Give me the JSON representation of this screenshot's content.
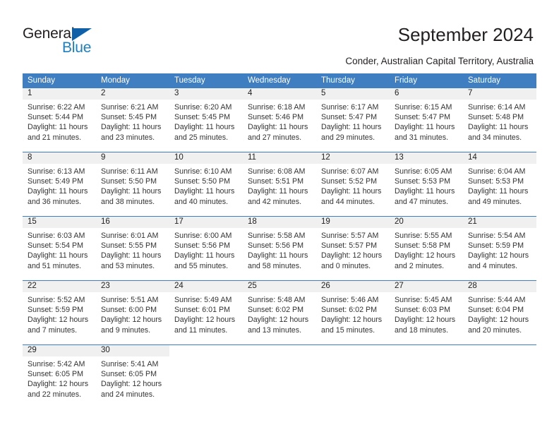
{
  "brand": {
    "logo_text_1": "General",
    "logo_text_2": "Blue",
    "logo_icon": "triangle-icon",
    "accent_color": "#1d7fc3",
    "header_blue": "#3f7fc1"
  },
  "header": {
    "title": "September 2024",
    "subtitle": "Conder, Australian Capital Territory, Australia"
  },
  "calendar": {
    "weekday_headers": [
      "Sunday",
      "Monday",
      "Tuesday",
      "Wednesday",
      "Thursday",
      "Friday",
      "Saturday"
    ],
    "weeks": [
      [
        {
          "day": "1",
          "sunrise": "Sunrise: 6:22 AM",
          "sunset": "Sunset: 5:44 PM",
          "daylight_1": "Daylight: 11 hours",
          "daylight_2": "and 21 minutes."
        },
        {
          "day": "2",
          "sunrise": "Sunrise: 6:21 AM",
          "sunset": "Sunset: 5:45 PM",
          "daylight_1": "Daylight: 11 hours",
          "daylight_2": "and 23 minutes."
        },
        {
          "day": "3",
          "sunrise": "Sunrise: 6:20 AM",
          "sunset": "Sunset: 5:45 PM",
          "daylight_1": "Daylight: 11 hours",
          "daylight_2": "and 25 minutes."
        },
        {
          "day": "4",
          "sunrise": "Sunrise: 6:18 AM",
          "sunset": "Sunset: 5:46 PM",
          "daylight_1": "Daylight: 11 hours",
          "daylight_2": "and 27 minutes."
        },
        {
          "day": "5",
          "sunrise": "Sunrise: 6:17 AM",
          "sunset": "Sunset: 5:47 PM",
          "daylight_1": "Daylight: 11 hours",
          "daylight_2": "and 29 minutes."
        },
        {
          "day": "6",
          "sunrise": "Sunrise: 6:15 AM",
          "sunset": "Sunset: 5:47 PM",
          "daylight_1": "Daylight: 11 hours",
          "daylight_2": "and 31 minutes."
        },
        {
          "day": "7",
          "sunrise": "Sunrise: 6:14 AM",
          "sunset": "Sunset: 5:48 PM",
          "daylight_1": "Daylight: 11 hours",
          "daylight_2": "and 34 minutes."
        }
      ],
      [
        {
          "day": "8",
          "sunrise": "Sunrise: 6:13 AM",
          "sunset": "Sunset: 5:49 PM",
          "daylight_1": "Daylight: 11 hours",
          "daylight_2": "and 36 minutes."
        },
        {
          "day": "9",
          "sunrise": "Sunrise: 6:11 AM",
          "sunset": "Sunset: 5:50 PM",
          "daylight_1": "Daylight: 11 hours",
          "daylight_2": "and 38 minutes."
        },
        {
          "day": "10",
          "sunrise": "Sunrise: 6:10 AM",
          "sunset": "Sunset: 5:50 PM",
          "daylight_1": "Daylight: 11 hours",
          "daylight_2": "and 40 minutes."
        },
        {
          "day": "11",
          "sunrise": "Sunrise: 6:08 AM",
          "sunset": "Sunset: 5:51 PM",
          "daylight_1": "Daylight: 11 hours",
          "daylight_2": "and 42 minutes."
        },
        {
          "day": "12",
          "sunrise": "Sunrise: 6:07 AM",
          "sunset": "Sunset: 5:52 PM",
          "daylight_1": "Daylight: 11 hours",
          "daylight_2": "and 44 minutes."
        },
        {
          "day": "13",
          "sunrise": "Sunrise: 6:05 AM",
          "sunset": "Sunset: 5:53 PM",
          "daylight_1": "Daylight: 11 hours",
          "daylight_2": "and 47 minutes."
        },
        {
          "day": "14",
          "sunrise": "Sunrise: 6:04 AM",
          "sunset": "Sunset: 5:53 PM",
          "daylight_1": "Daylight: 11 hours",
          "daylight_2": "and 49 minutes."
        }
      ],
      [
        {
          "day": "15",
          "sunrise": "Sunrise: 6:03 AM",
          "sunset": "Sunset: 5:54 PM",
          "daylight_1": "Daylight: 11 hours",
          "daylight_2": "and 51 minutes."
        },
        {
          "day": "16",
          "sunrise": "Sunrise: 6:01 AM",
          "sunset": "Sunset: 5:55 PM",
          "daylight_1": "Daylight: 11 hours",
          "daylight_2": "and 53 minutes."
        },
        {
          "day": "17",
          "sunrise": "Sunrise: 6:00 AM",
          "sunset": "Sunset: 5:56 PM",
          "daylight_1": "Daylight: 11 hours",
          "daylight_2": "and 55 minutes."
        },
        {
          "day": "18",
          "sunrise": "Sunrise: 5:58 AM",
          "sunset": "Sunset: 5:56 PM",
          "daylight_1": "Daylight: 11 hours",
          "daylight_2": "and 58 minutes."
        },
        {
          "day": "19",
          "sunrise": "Sunrise: 5:57 AM",
          "sunset": "Sunset: 5:57 PM",
          "daylight_1": "Daylight: 12 hours",
          "daylight_2": "and 0 minutes."
        },
        {
          "day": "20",
          "sunrise": "Sunrise: 5:55 AM",
          "sunset": "Sunset: 5:58 PM",
          "daylight_1": "Daylight: 12 hours",
          "daylight_2": "and 2 minutes."
        },
        {
          "day": "21",
          "sunrise": "Sunrise: 5:54 AM",
          "sunset": "Sunset: 5:59 PM",
          "daylight_1": "Daylight: 12 hours",
          "daylight_2": "and 4 minutes."
        }
      ],
      [
        {
          "day": "22",
          "sunrise": "Sunrise: 5:52 AM",
          "sunset": "Sunset: 5:59 PM",
          "daylight_1": "Daylight: 12 hours",
          "daylight_2": "and 7 minutes."
        },
        {
          "day": "23",
          "sunrise": "Sunrise: 5:51 AM",
          "sunset": "Sunset: 6:00 PM",
          "daylight_1": "Daylight: 12 hours",
          "daylight_2": "and 9 minutes."
        },
        {
          "day": "24",
          "sunrise": "Sunrise: 5:49 AM",
          "sunset": "Sunset: 6:01 PM",
          "daylight_1": "Daylight: 12 hours",
          "daylight_2": "and 11 minutes."
        },
        {
          "day": "25",
          "sunrise": "Sunrise: 5:48 AM",
          "sunset": "Sunset: 6:02 PM",
          "daylight_1": "Daylight: 12 hours",
          "daylight_2": "and 13 minutes."
        },
        {
          "day": "26",
          "sunrise": "Sunrise: 5:46 AM",
          "sunset": "Sunset: 6:02 PM",
          "daylight_1": "Daylight: 12 hours",
          "daylight_2": "and 15 minutes."
        },
        {
          "day": "27",
          "sunrise": "Sunrise: 5:45 AM",
          "sunset": "Sunset: 6:03 PM",
          "daylight_1": "Daylight: 12 hours",
          "daylight_2": "and 18 minutes."
        },
        {
          "day": "28",
          "sunrise": "Sunrise: 5:44 AM",
          "sunset": "Sunset: 6:04 PM",
          "daylight_1": "Daylight: 12 hours",
          "daylight_2": "and 20 minutes."
        }
      ],
      [
        {
          "day": "29",
          "sunrise": "Sunrise: 5:42 AM",
          "sunset": "Sunset: 6:05 PM",
          "daylight_1": "Daylight: 12 hours",
          "daylight_2": "and 22 minutes."
        },
        {
          "day": "30",
          "sunrise": "Sunrise: 5:41 AM",
          "sunset": "Sunset: 6:05 PM",
          "daylight_1": "Daylight: 12 hours",
          "daylight_2": "and 24 minutes."
        },
        {
          "day": "",
          "sunrise": "",
          "sunset": "",
          "daylight_1": "",
          "daylight_2": ""
        },
        {
          "day": "",
          "sunrise": "",
          "sunset": "",
          "daylight_1": "",
          "daylight_2": ""
        },
        {
          "day": "",
          "sunrise": "",
          "sunset": "",
          "daylight_1": "",
          "daylight_2": ""
        },
        {
          "day": "",
          "sunrise": "",
          "sunset": "",
          "daylight_1": "",
          "daylight_2": ""
        },
        {
          "day": "",
          "sunrise": "",
          "sunset": "",
          "daylight_1": "",
          "daylight_2": ""
        }
      ]
    ]
  }
}
